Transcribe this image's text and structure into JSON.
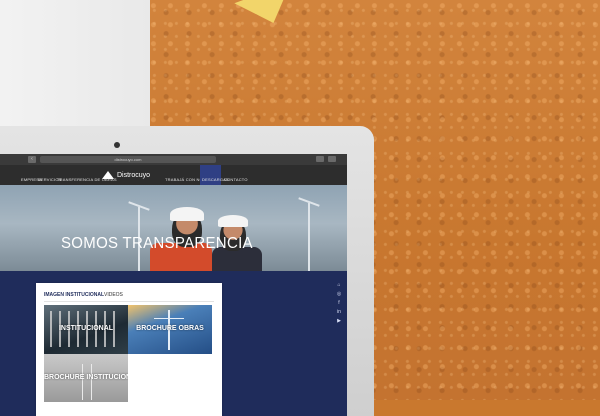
{
  "browser": {
    "url": "distrocuyo.com",
    "back_label": "‹"
  },
  "site": {
    "logo_text": "Distrocuyo",
    "nav": [
      {
        "label": "EMPRESA"
      },
      {
        "label": "SERVICIOS"
      },
      {
        "label": "TRANSFERENCIA DE OBRAS"
      },
      {
        "label": "TRABAJÁ CON NOSOTROS"
      },
      {
        "label": "DESCARGAS"
      },
      {
        "label": "CONTACTO"
      }
    ]
  },
  "hero": {
    "title": "SOMOS TRANSPARENCIA"
  },
  "social": {
    "icons": [
      "",
      "instagram-icon",
      "facebook-icon",
      "linkedin-icon",
      "youtube-icon"
    ],
    "glyphs": [
      "⌂",
      "◎",
      "f",
      "in",
      "▶"
    ]
  },
  "panel": {
    "tabs": [
      "IMAGEN INSTITUCIONAL",
      "VIDEOS"
    ],
    "tiles": [
      {
        "label": "INSTITUCIONAL"
      },
      {
        "label": "BROCHURE OBRAS"
      },
      {
        "label": "BROCHURE INSTITUCIONAL"
      }
    ]
  },
  "colors": {
    "navy": "#1f2c5b",
    "nav_active": "#2f3f84",
    "cork": "#c9782e"
  }
}
